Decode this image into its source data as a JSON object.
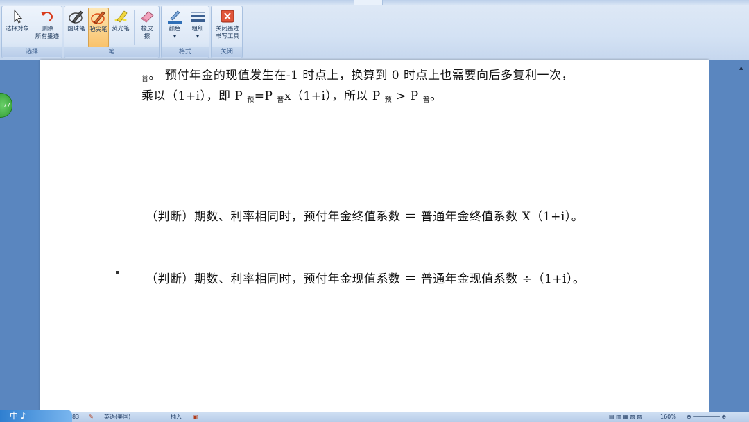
{
  "ribbon": {
    "groups": [
      {
        "label": "选择",
        "buttons": [
          {
            "name": "select-object-button",
            "label": "选择对象",
            "icon": "arrow-cursor-icon"
          },
          {
            "name": "delete-all-ink-button",
            "label": "删除\n所有墨迹",
            "icon": "undo-ink-icon"
          }
        ]
      },
      {
        "label": "笔",
        "buttons": [
          {
            "name": "ballpoint-pen-button",
            "label": "圆珠笔",
            "icon": "ballpoint-pen-icon"
          },
          {
            "name": "felt-tip-pen-button",
            "label": "毡尖笔",
            "icon": "felt-tip-pen-icon",
            "active": true
          },
          {
            "name": "highlighter-button",
            "label": "荧光笔",
            "icon": "highlighter-icon"
          },
          {
            "name": "eraser-button",
            "label": "橡皮\n擦",
            "icon": "eraser-icon"
          }
        ]
      },
      {
        "label": "格式",
        "buttons": [
          {
            "name": "color-button",
            "label": "颜色",
            "icon": "color-icon"
          },
          {
            "name": "thickness-button",
            "label": "粗细",
            "icon": "thickness-icon"
          }
        ]
      },
      {
        "label": "关闭",
        "buttons": [
          {
            "name": "close-ink-tools-button",
            "label": "关闭墨迹\n书写工具",
            "icon": "close-icon"
          }
        ]
      }
    ],
    "accent": "#f9c26b"
  },
  "document": {
    "line1": {
      "p1": "普",
      "p2": "。 预付年金的现值发生在-1 时点上，换算到 0 时点上也需要向后多复利一次，"
    },
    "line2": {
      "a": "乘以（1+i），即 P ",
      "s1": "预",
      "b": "=P ",
      "s2": "普",
      "c": "x（1+i），所以 P ",
      "s3": "预",
      "d": " > P ",
      "s4": "普",
      "e": "。"
    },
    "line3": "（判断）期数、利率相同时，预付年金终值系数 ＝ 普通年金终值系数 X（1+i）。",
    "line4": "（判断）期数、利率相同时，预付年金现值系数 ＝ 普通年金现值系数 ÷（1+i）。"
  },
  "side_badge": "77",
  "status": {
    "ime": "中 ♪ ",
    "page": "83",
    "language": "英语(美国)",
    "insert": "插入",
    "zoom": "160%"
  }
}
